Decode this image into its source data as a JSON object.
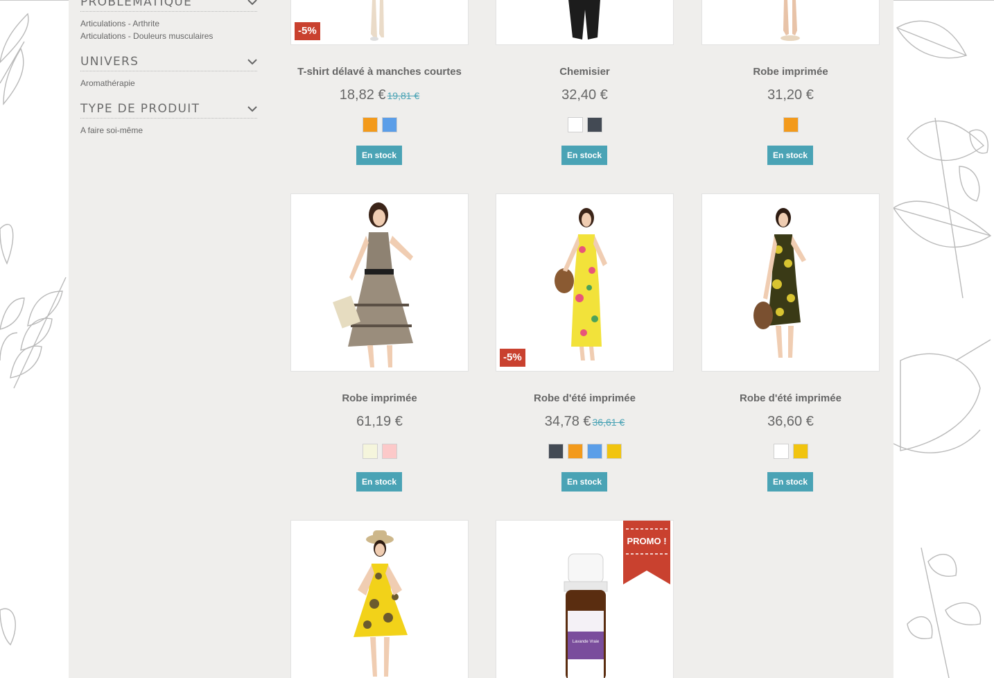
{
  "sidebar": {
    "facets": [
      {
        "title": "PROBLÉMATIQUE",
        "items": [
          "Articulations - Arthrite",
          "Articulations - Douleurs musculaires"
        ]
      },
      {
        "title": "UNIVERS",
        "items": [
          "Aromathérapie"
        ]
      },
      {
        "title": "TYPE DE PRODUIT",
        "items": [
          "A faire soi-même"
        ]
      }
    ]
  },
  "products": [
    {
      "name": "T-shirt délavé à manches courtes",
      "price": "18,82 €",
      "old_price": "19,81 €",
      "discount": "-5%",
      "colors": [
        "#f39a1b",
        "#5b9ee8"
      ],
      "stock": "En stock"
    },
    {
      "name": "Chemisier",
      "price": "32,40 €",
      "old_price": "",
      "discount": "",
      "colors": [
        "#ffffff",
        "#434a54"
      ],
      "stock": "En stock"
    },
    {
      "name": "Robe imprimée",
      "price": "31,20 €",
      "old_price": "",
      "discount": "",
      "colors": [
        "#f39a1b"
      ],
      "stock": "En stock"
    },
    {
      "name": "Robe imprimée",
      "price": "61,19 €",
      "old_price": "",
      "discount": "",
      "colors": [
        "#f5f5dc",
        "#fcc9c9"
      ],
      "stock": "En stock"
    },
    {
      "name": "Robe d'été imprimée",
      "price": "34,78 €",
      "old_price": "36,61 €",
      "discount": "-5%",
      "colors": [
        "#434a54",
        "#f39a1b",
        "#5b9ee8",
        "#f1c40f"
      ],
      "stock": "En stock"
    },
    {
      "name": "Robe d'été imprimée",
      "price": "36,60 €",
      "old_price": "",
      "discount": "",
      "colors": [
        "#ffffff",
        "#f1c40f"
      ],
      "stock": "En stock"
    },
    {
      "name": "",
      "price": "",
      "old_price": "",
      "discount": "",
      "colors": [],
      "stock": ""
    },
    {
      "name": "",
      "price": "",
      "old_price": "",
      "discount": "",
      "colors": [],
      "stock": "",
      "ribbon": "PROMO !",
      "label_text": "Lavande Vraie"
    }
  ],
  "theme": {
    "accent": "#4aa3b5",
    "badge": "#c9412f",
    "page_bg": "#efeeec"
  }
}
